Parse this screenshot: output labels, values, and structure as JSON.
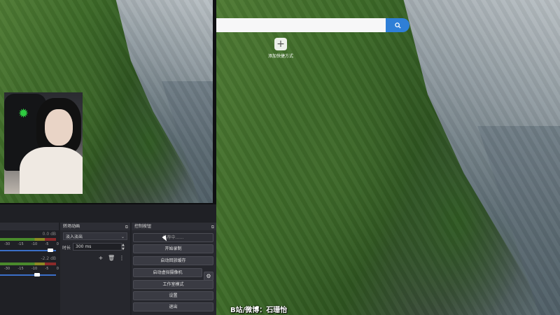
{
  "browser": {
    "search_placeholder": "",
    "shortcut_label": "添加快捷方式",
    "watermark": "B站/微博：石珊怡"
  },
  "transition_panel": {
    "title": "转场动画",
    "selected_transition": "淡入淡出",
    "duration_label": "时长",
    "duration_value": "300 ms"
  },
  "controls_panel": {
    "title": "控制按钮",
    "status_text": "推荐中……",
    "buttons": {
      "start_recording": "开始录制",
      "start_replay_buffer": "启动回放缓存",
      "start_virtual_camera": "启动虚拟摄像机",
      "studio_mode": "工作室模式",
      "settings": "设置",
      "exit": "退出"
    }
  },
  "mixer": {
    "track1_db": "0.0 dB",
    "track2_db": "-2.2 dB",
    "scale": [
      "-30",
      "-15",
      "-10",
      "-5",
      "0"
    ],
    "track1_volume": 0.95,
    "track2_volume": 0.68
  },
  "icons": {
    "search": "search-icon",
    "plus": "plus-icon",
    "gear": "gear-icon",
    "razer": "razer-logo-icon"
  },
  "colors": {
    "accent": "#2f7fd7",
    "panel": "#26272d"
  }
}
